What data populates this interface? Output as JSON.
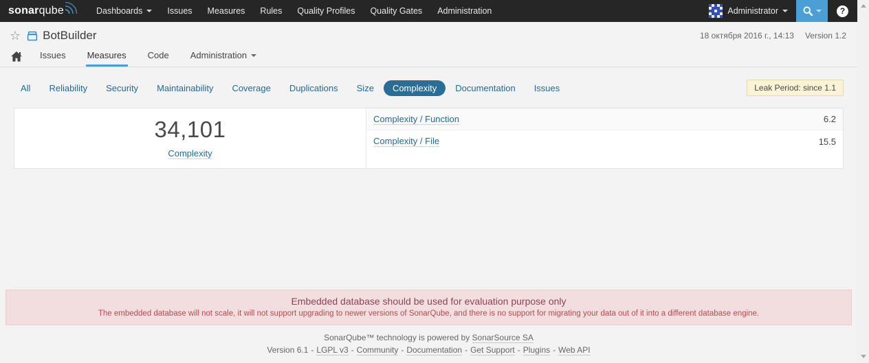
{
  "navbar": {
    "logo_bold": "sonar",
    "logo_light": "qube",
    "items": [
      {
        "label": "Dashboards",
        "has_caret": true
      },
      {
        "label": "Issues"
      },
      {
        "label": "Measures"
      },
      {
        "label": "Rules"
      },
      {
        "label": "Quality Profiles"
      },
      {
        "label": "Quality Gates"
      },
      {
        "label": "Administration"
      }
    ],
    "user_name": "Administrator"
  },
  "project": {
    "name": "BotBuilder",
    "date": "18 октября 2016 г., 14:13",
    "version": "Version 1.2",
    "tabs": [
      {
        "label": "Issues"
      },
      {
        "label": "Measures",
        "active": true
      },
      {
        "label": "Code"
      },
      {
        "label": "Administration",
        "has_caret": true
      }
    ]
  },
  "measure_tabs": {
    "items": [
      {
        "label": "All"
      },
      {
        "label": "Reliability"
      },
      {
        "label": "Security"
      },
      {
        "label": "Maintainability"
      },
      {
        "label": "Coverage"
      },
      {
        "label": "Duplications"
      },
      {
        "label": "Size"
      },
      {
        "label": "Complexity",
        "selected": true
      },
      {
        "label": "Documentation"
      },
      {
        "label": "Issues"
      }
    ],
    "leak_period": "Leak Period: since 1.1"
  },
  "measures": {
    "main": {
      "value": "34,101",
      "label": "Complexity"
    },
    "related": [
      {
        "label": "Complexity / Function",
        "value": "6.2"
      },
      {
        "label": "Complexity / File",
        "value": "15.5"
      }
    ]
  },
  "warning": {
    "title": "Embedded database should be used for evaluation purpose only",
    "detail": "The embedded database will not scale, it will not support upgrading to newer versions of SonarQube, and there is no support for migrating your data out of it into a different database engine."
  },
  "footer": {
    "line1_prefix": "SonarQube™ technology is powered by ",
    "line1_link": "SonarSource SA",
    "version": "Version 6.1",
    "sep": "-",
    "links": [
      "LGPL v3",
      "Community",
      "Documentation",
      "Get Support",
      "Plugins",
      "Web API"
    ]
  },
  "colors": {
    "navbar_bg": "#262626",
    "accent_blue": "#4b9fd5",
    "link_blue": "#236a97",
    "selected_tab_bg": "#2a6d96",
    "leak_badge_bg": "#fbf3d5",
    "warning_bg": "#f2dede",
    "warning_text": "#a94442",
    "page_bg": "#f3f3f3"
  }
}
